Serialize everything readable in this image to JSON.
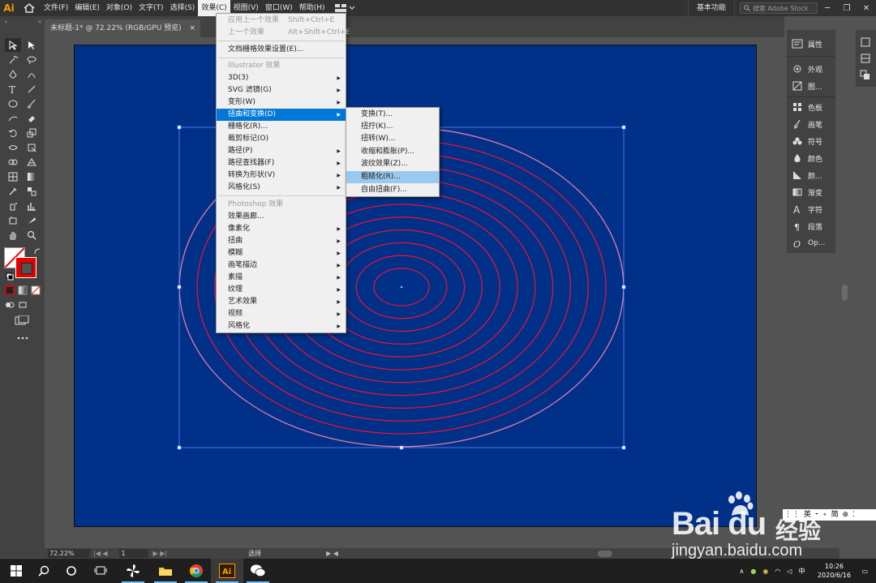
{
  "app": {
    "logo": "Ai",
    "workspace": "基本功能",
    "search_placeholder": "搜索 Adobe Stock"
  },
  "menubar": {
    "items": [
      "文件(F)",
      "编辑(E)",
      "对象(O)",
      "文字(T)",
      "选择(S)",
      "效果(C)",
      "视图(V)",
      "窗口(W)",
      "帮助(H)"
    ],
    "active": "效果(C)"
  },
  "document": {
    "tab_title": "未标题-1* @ 72.22% (RGB/GPU 预览)",
    "close": "×"
  },
  "effect_menu": {
    "apply_last": "应用上一个效果",
    "apply_last_shortcut": "Shift+Ctrl+E",
    "last_effect": "上一个效果",
    "last_effect_shortcut": "Alt+Shift+Ctrl+E",
    "raster_settings": "文档栅格效果设置(E)...",
    "illustrator_header": "Illustrator 效果",
    "illustrator_items": [
      "3D(3)",
      "SVG 滤镜(G)",
      "变形(W)",
      "扭曲和变换(D)",
      "栅格化(R)...",
      "裁剪标记(O)",
      "路径(P)",
      "路径查找器(F)",
      "转换为形状(V)",
      "风格化(S)"
    ],
    "photoshop_header": "Photoshop 效果",
    "photoshop_items": [
      "效果画廊...",
      "像素化",
      "扭曲",
      "模糊",
      "画笔描边",
      "素描",
      "纹理",
      "艺术效果",
      "视频",
      "风格化"
    ],
    "highlighted": "扭曲和变换(D)"
  },
  "distort_submenu": {
    "items": [
      "变换(T)...",
      "扭拧(K)...",
      "扭转(W)...",
      "收缩和膨胀(P)...",
      "波纹效果(Z)...",
      "粗糙化(R)...",
      "自由扭曲(F)..."
    ],
    "highlighted": "粗糙化(R)..."
  },
  "right_panel": {
    "items": [
      "属性",
      "外观",
      "图...",
      "色板",
      "画笔",
      "符号",
      "颜色",
      "颜...",
      "渐变",
      "字符",
      "段落",
      "Op..."
    ]
  },
  "statusbar": {
    "zoom": "72.22%",
    "page": "1",
    "tool": "选择"
  },
  "taskbar": {
    "time": "10:26",
    "date": "2020/6/16"
  },
  "watermark": {
    "brand": "Bai du",
    "cn": "经验",
    "url": "jingyan.baidu.com",
    "overlay": "⋮⋮ 英 ⁃ ∘ 简 ⊛ ⁚"
  },
  "colors": {
    "artboard": "#003087",
    "rings": "#e0143c",
    "menu_highlight": "#0078d7",
    "submenu_highlight": "#99c9ef"
  }
}
